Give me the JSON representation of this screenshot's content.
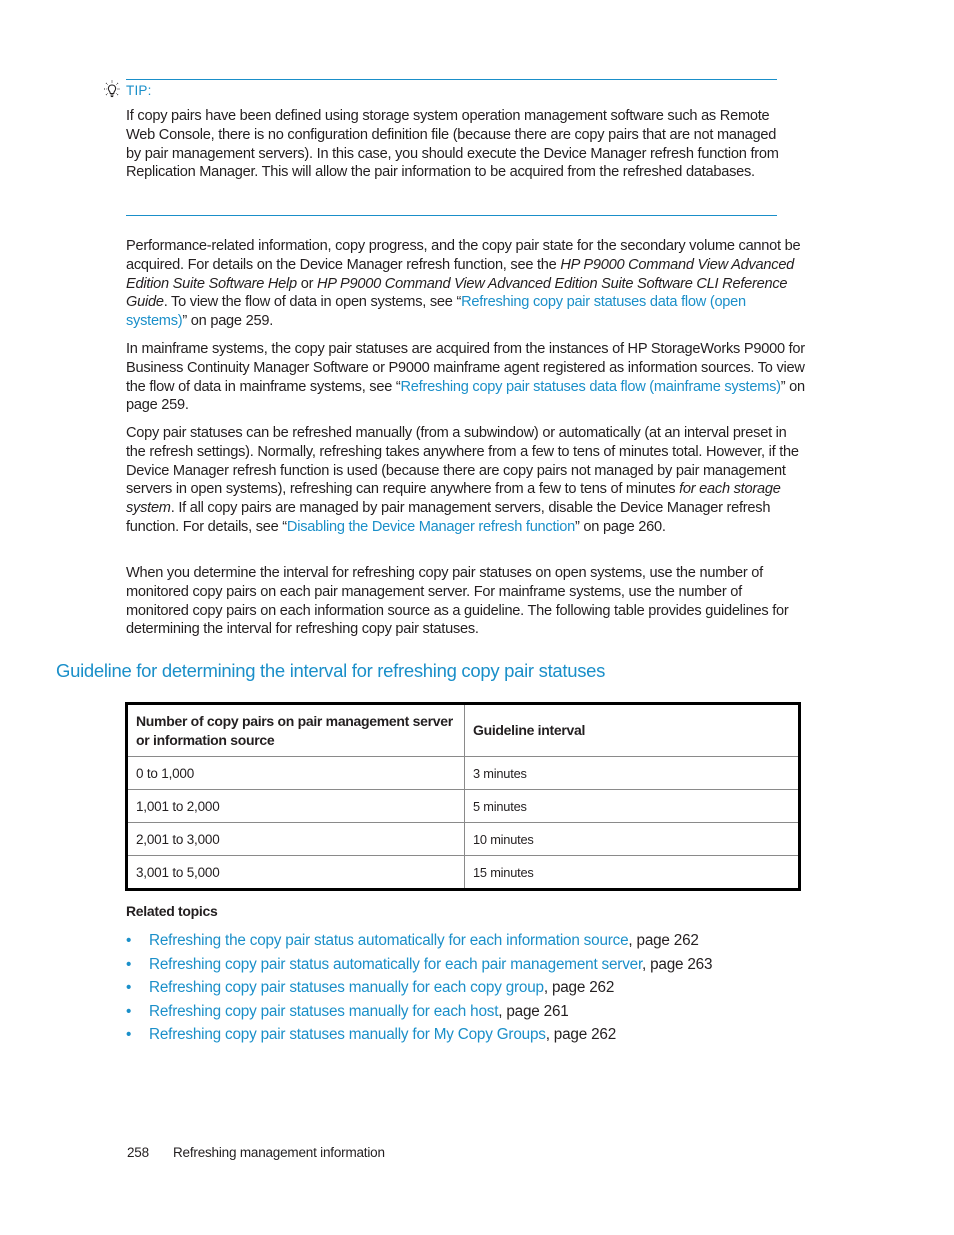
{
  "tip": {
    "icon": "lightbulb-icon",
    "label": "TIP:",
    "body": "If copy pairs have been defined using storage system operation management software such as Remote Web Console, there is no configuration definition file (because there are copy pairs that are not managed by pair management servers). In this case, you should execute the Device Manager refresh function from Replication Manager. This will allow the pair information to be acquired from the refreshed databases."
  },
  "paragraphs": {
    "p1": {
      "text1": "Performance-related information, copy progress, and the copy pair state for the secondary volume cannot be acquired. For details on the Device Manager refresh function, see the ",
      "italic1": "HP P9000 Command View Advanced Edition Suite Software Help",
      "text2": " or ",
      "italic2": "HP P9000 Command View Advanced Edition Suite Software CLI Reference Guide",
      "text3": ".  To view the flow of data in open systems, see “",
      "link": "Refreshing copy pair statuses data flow (open systems)",
      "text4": "” on page 259."
    },
    "p2": {
      "text1": "In mainframe systems, the copy pair statuses are acquired from the instances of HP StorageWorks P9000 for Business Continuity Manager Software or P9000 mainframe agent registered as information sources. To view the flow of data in mainframe systems, see “",
      "link": "Refreshing copy pair statuses data flow (mainframe systems)",
      "text2": "” on page 259."
    },
    "p3": {
      "text1": "Copy pair statuses can be refreshed manually (from a subwindow) or automatically (at an interval preset in the refresh settings). Normally, refreshing takes anywhere from a few to tens of minutes total. However, if the Device Manager refresh function is used (because there are copy pairs not managed by pair management servers in open systems), refreshing can require anywhere from a few to tens of minutes ",
      "italic1": "for each storage system",
      "text2": ". If all copy pairs are managed by pair management servers, disable the Device Manager refresh function. For details, see “",
      "link": "Disabling the Device Manager refresh function",
      "text3": "” on page 260."
    },
    "p4": {
      "text": "When you determine the interval for refreshing copy pair statuses on open systems, use the number of monitored copy pairs on each pair management server. For mainframe systems, use the number of monitored copy pairs on each information source as a guideline. The following table provides guidelines for determining the interval for refreshing copy pair statuses."
    }
  },
  "section": {
    "title": "Guideline for determining the interval for refreshing copy pair statuses"
  },
  "table": {
    "headers": [
      "Number of copy pairs on pair management server or information source",
      "Guideline interval"
    ],
    "rows": [
      [
        "0 to 1,000",
        "3 minutes"
      ],
      [
        "1,001 to 2,000",
        "5 minutes"
      ],
      [
        "2,001 to 3,000",
        "10 minutes"
      ],
      [
        "3,001 to 5,000",
        "15 minutes"
      ]
    ]
  },
  "related": {
    "title": "Related topics",
    "bullet": "•",
    "items": [
      {
        "link": "Refreshing the copy pair status automatically for each information source",
        "suffix": ", page 262"
      },
      {
        "link": "Refreshing copy pair status automatically for each pair management server",
        "suffix": ", page 263"
      },
      {
        "link": "Refreshing copy pair statuses manually for each copy group",
        "suffix": ", page 262"
      },
      {
        "link": "Refreshing copy pair statuses manually for each host",
        "suffix": ", page 261"
      },
      {
        "link": "Refreshing copy pair statuses manually for My Copy Groups",
        "suffix": ", page 262"
      }
    ]
  },
  "footer": {
    "page_number": "258",
    "chapter": "Refreshing management information"
  },
  "colors": {
    "accent": "#1a8fc9",
    "text": "#231f20",
    "table_border": "#000000"
  }
}
